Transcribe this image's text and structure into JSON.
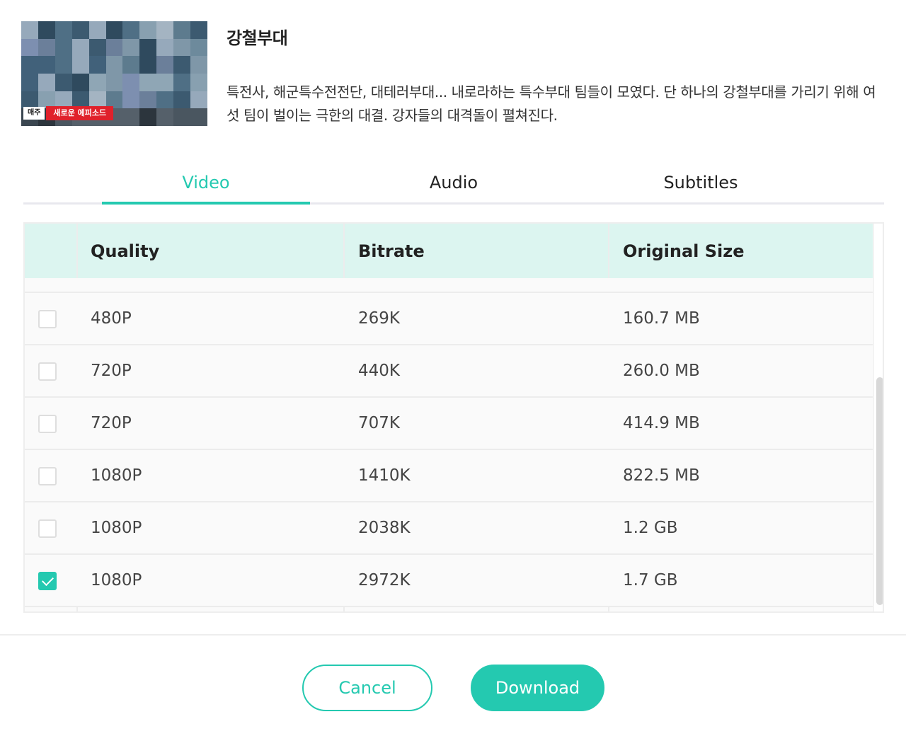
{
  "header": {
    "thumbnail": {
      "badge_weekly": "매주",
      "badge_new": "새로운 에피소드"
    },
    "title": "강철부대",
    "description": "특전사, 해군특수전전단, 대테러부대... 내로라하는 특수부대 팀들이 모였다. 단 하나의 강철부대를 가리기 위해 여섯 팀이 벌이는 극한의 대결. 강자들의 대격돌이 펼쳐진다."
  },
  "tabs": [
    {
      "label": "Video",
      "active": true
    },
    {
      "label": "Audio",
      "active": false
    },
    {
      "label": "Subtitles",
      "active": false
    }
  ],
  "table": {
    "columns": [
      "Quality",
      "Bitrate",
      "Original Size"
    ],
    "rows": [
      {
        "quality": "480P",
        "bitrate": "269K",
        "size": "160.7 MB",
        "checked": false
      },
      {
        "quality": "720P",
        "bitrate": "440K",
        "size": "260.0 MB",
        "checked": false
      },
      {
        "quality": "720P",
        "bitrate": "707K",
        "size": "414.9 MB",
        "checked": false
      },
      {
        "quality": "1080P",
        "bitrate": "1410K",
        "size": "822.5 MB",
        "checked": false
      },
      {
        "quality": "1080P",
        "bitrate": "2038K",
        "size": "1.2 GB",
        "checked": false
      },
      {
        "quality": "1080P",
        "bitrate": "2972K",
        "size": "1.7 GB",
        "checked": true
      }
    ]
  },
  "buttons": {
    "cancel": "Cancel",
    "download": "Download"
  },
  "colors": {
    "accent": "#24c9b0",
    "header_bg": "#dcf5f0",
    "badge_red": "#e0212b"
  }
}
